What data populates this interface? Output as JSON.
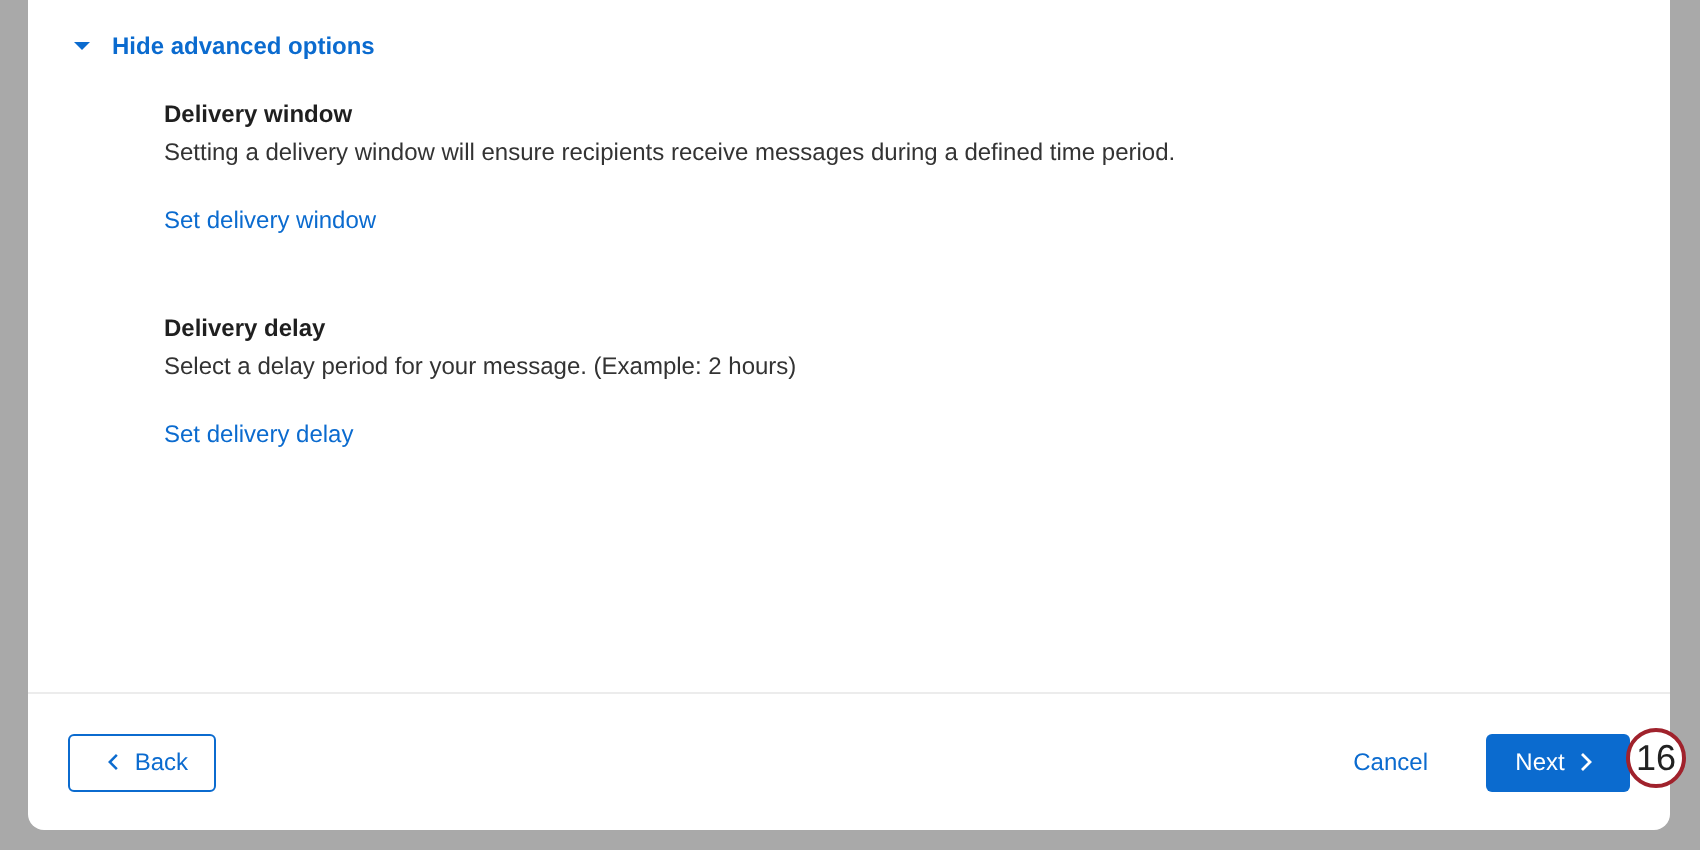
{
  "advanced_toggle": {
    "label": "Hide advanced options",
    "expanded": true
  },
  "sections": [
    {
      "title": "Delivery window",
      "description": "Setting a delivery window will ensure recipients receive messages during a defined time period.",
      "link": "Set delivery window"
    },
    {
      "title": "Delivery delay",
      "description": "Select a delay period for your message. (Example: 2 hours)",
      "link": "Set delivery delay"
    }
  ],
  "footer": {
    "back": "Back",
    "cancel": "Cancel",
    "next": "Next"
  },
  "step_badge": "16"
}
